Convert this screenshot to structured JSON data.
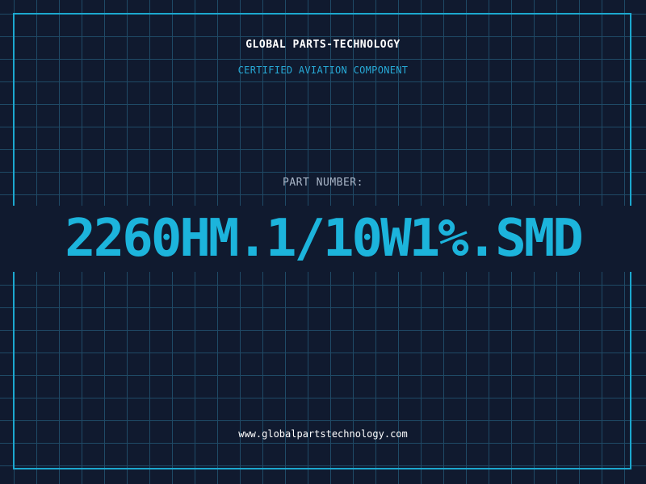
{
  "header": {
    "company_name": "GLOBAL PARTS-TECHNOLOGY",
    "tagline": "CERTIFIED AVIATION COMPONENT"
  },
  "part": {
    "label": "PART NUMBER:",
    "number": "2260HM.1/10W1%.SMD"
  },
  "footer": {
    "website": "www.globalpartstechnology.com"
  },
  "colors": {
    "background": "#101a2f",
    "grid": "#1f4a66",
    "accent": "#1cb4dc",
    "frame": "#1ca8cf",
    "label": "#a9b6c8",
    "text": "#ffffff"
  }
}
